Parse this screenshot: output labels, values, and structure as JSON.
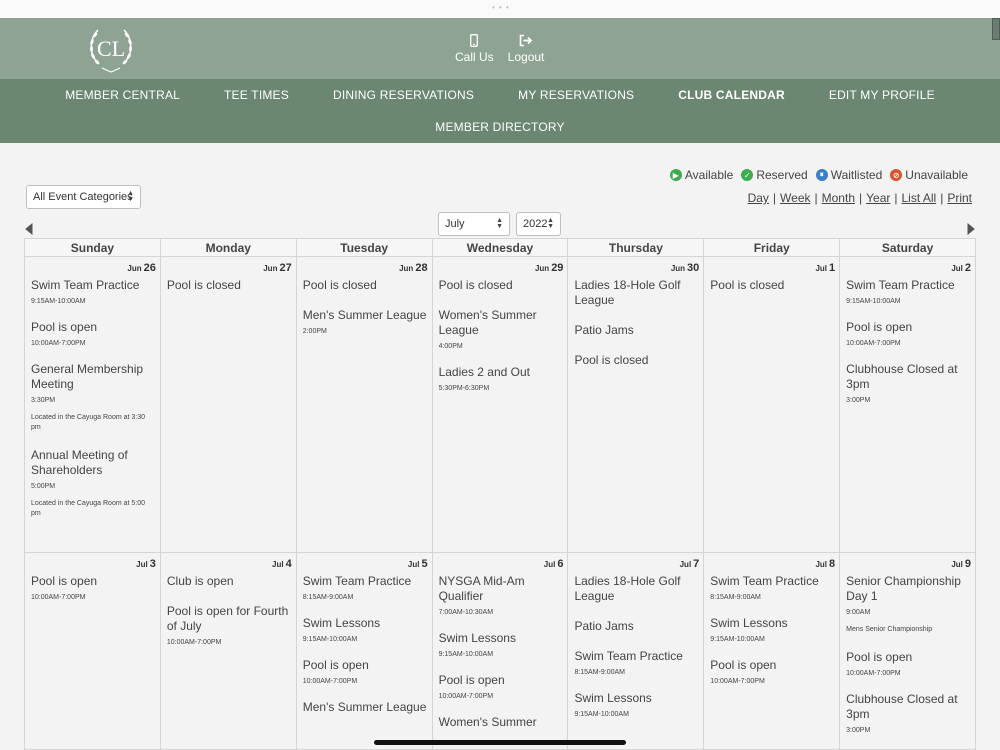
{
  "header": {
    "logo_letters": "CL",
    "actions": [
      {
        "label": "Call Us",
        "icon": "phone-icon"
      },
      {
        "label": "Logout",
        "icon": "logout-icon"
      }
    ]
  },
  "nav": {
    "row1": [
      "MEMBER CENTRAL",
      "TEE TIMES",
      "DINING RESERVATIONS",
      "MY RESERVATIONS",
      "CLUB CALENDAR",
      "EDIT MY PROFILE"
    ],
    "row2": [
      "MEMBER DIRECTORY"
    ],
    "active": "CLUB CALENDAR"
  },
  "legend": [
    {
      "label": "Available",
      "color": "#3dab4f",
      "glyph": "▶"
    },
    {
      "label": "Reserved",
      "color": "#3dab4f",
      "glyph": "✓"
    },
    {
      "label": "Waitlisted",
      "color": "#3b7fc4",
      "glyph": "⏸"
    },
    {
      "label": "Unavailable",
      "color": "#d9542c",
      "glyph": "⊘"
    }
  ],
  "views": [
    "Day",
    "Week",
    "Month",
    "Year",
    "List All",
    "Print"
  ],
  "filters": {
    "category": "All Event Categories",
    "month": "July",
    "year": "2022"
  },
  "weekdays": [
    "Sunday",
    "Monday",
    "Tuesday",
    "Wednesday",
    "Thursday",
    "Friday",
    "Saturday"
  ],
  "weeks": [
    [
      {
        "mon": "Jun",
        "day": "26",
        "events": [
          {
            "title": "Swim Team Practice",
            "time": "9:15AM-10:00AM"
          },
          {
            "title": "Pool is open",
            "time": "10:00AM-7:00PM"
          },
          {
            "title": "General Membership Meeting",
            "time": "3:30PM",
            "note": "Located in the Cayuga Room at 3:30 pm"
          },
          {
            "title": "Annual Meeting of Shareholders",
            "time": "5:00PM",
            "note": "Located in the Cayuga Room at 5:00 pm"
          }
        ]
      },
      {
        "mon": "Jun",
        "day": "27",
        "events": [
          {
            "title": "Pool is closed"
          }
        ]
      },
      {
        "mon": "Jun",
        "day": "28",
        "events": [
          {
            "title": "Pool is closed"
          },
          {
            "title": "Men's Summer League",
            "time": "2:00PM"
          }
        ]
      },
      {
        "mon": "Jun",
        "day": "29",
        "events": [
          {
            "title": "Pool is closed"
          },
          {
            "title": "Women's Summer League",
            "time": "4:00PM"
          },
          {
            "title": "Ladies 2 and Out",
            "time": "5:30PM-6:30PM"
          }
        ]
      },
      {
        "mon": "Jun",
        "day": "30",
        "events": [
          {
            "title": "Ladies 18-Hole Golf League"
          },
          {
            "title": "Patio Jams"
          },
          {
            "title": "Pool is closed"
          }
        ]
      },
      {
        "mon": "Jul",
        "day": "1",
        "events": [
          {
            "title": "Pool is closed"
          }
        ]
      },
      {
        "mon": "Jul",
        "day": "2",
        "events": [
          {
            "title": "Swim Team Practice",
            "time": "9:15AM-10:00AM"
          },
          {
            "title": "Pool is open",
            "time": "10:00AM-7:00PM"
          },
          {
            "title": "Clubhouse Closed at 3pm",
            "time": "3:00PM"
          }
        ]
      }
    ],
    [
      {
        "mon": "Jul",
        "day": "3",
        "events": [
          {
            "title": "Pool is open",
            "time": "10:00AM-7:00PM"
          }
        ]
      },
      {
        "mon": "Jul",
        "day": "4",
        "events": [
          {
            "title": "Club is open"
          },
          {
            "title": "Pool is open for Fourth of July",
            "time": "10:00AM-7:00PM"
          }
        ]
      },
      {
        "mon": "Jul",
        "day": "5",
        "events": [
          {
            "title": "Swim Team Practice",
            "time": "8:15AM-9:00AM"
          },
          {
            "title": "Swim Lessons",
            "time": "9:15AM-10:00AM"
          },
          {
            "title": "Pool is open",
            "time": "10:00AM-7:00PM"
          },
          {
            "title": "Men's Summer League"
          }
        ]
      },
      {
        "mon": "Jul",
        "day": "6",
        "events": [
          {
            "title": "NYSGA Mid-Am Qualifier",
            "time": "7:00AM-10:30AM"
          },
          {
            "title": "Swim Lessons",
            "time": "9:15AM-10:00AM"
          },
          {
            "title": "Pool is open",
            "time": "10:00AM-7:00PM"
          },
          {
            "title": "Women's Summer"
          }
        ]
      },
      {
        "mon": "Jul",
        "day": "7",
        "events": [
          {
            "title": "Ladies 18-Hole Golf League"
          },
          {
            "title": "Patio Jams"
          },
          {
            "title": "Swim Team Practice",
            "time": "8:15AM-9:00AM"
          },
          {
            "title": "Swim Lessons",
            "time": "9:15AM-10:00AM"
          }
        ]
      },
      {
        "mon": "Jul",
        "day": "8",
        "events": [
          {
            "title": "Swim Team Practice",
            "time": "8:15AM-9:00AM"
          },
          {
            "title": "Swim Lessons",
            "time": "9:15AM-10:00AM"
          },
          {
            "title": "Pool is open",
            "time": "10:00AM-7:00PM"
          }
        ]
      },
      {
        "mon": "Jul",
        "day": "9",
        "events": [
          {
            "title": "Senior Championship Day 1",
            "time": "9:00AM",
            "note": "Mens Senior Championship"
          },
          {
            "title": "Pool is open",
            "time": "10:00AM-7:00PM"
          },
          {
            "title": "Clubhouse Closed at 3pm",
            "time": "3:00PM"
          }
        ]
      }
    ]
  ]
}
